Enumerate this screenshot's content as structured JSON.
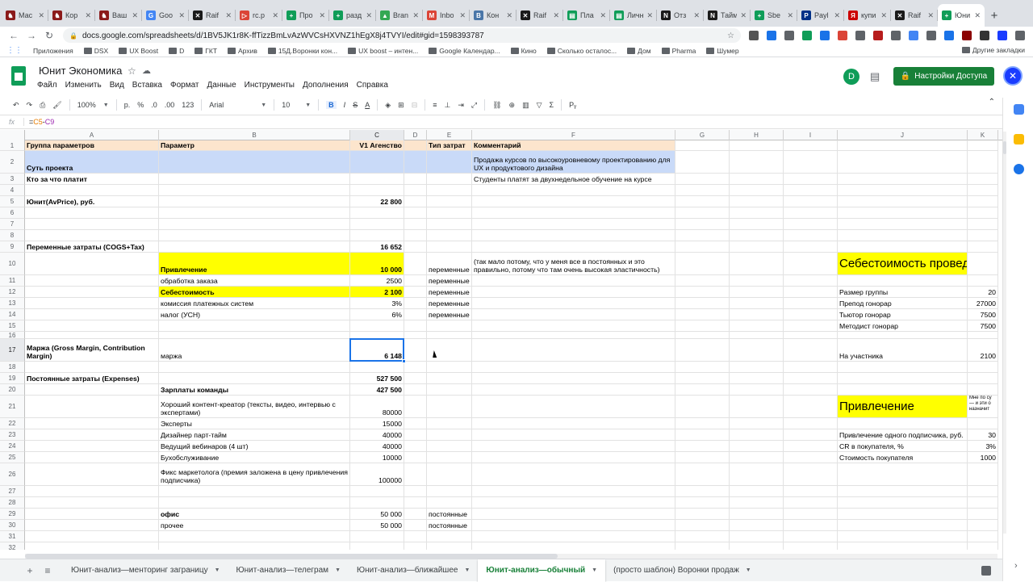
{
  "browser": {
    "tabs": [
      {
        "label": "Мас",
        "fav": "#8b1a1a",
        "glyph": "♞"
      },
      {
        "label": "Кор",
        "fav": "#8b1a1a",
        "glyph": "♞"
      },
      {
        "label": "Ваш",
        "fav": "#8b1a1a",
        "glyph": "♞"
      },
      {
        "label": "Goo",
        "fav": "#4285f4",
        "glyph": "G"
      },
      {
        "label": "Raif",
        "fav": "#1a1a1a",
        "glyph": "✕"
      },
      {
        "label": "rc.p",
        "fav": "#db4437",
        "glyph": "▷"
      },
      {
        "label": "Про",
        "fav": "#0f9d58",
        "glyph": "+"
      },
      {
        "label": "разд",
        "fav": "#0f9d58",
        "glyph": "+"
      },
      {
        "label": "Bran",
        "fav": "#34a853",
        "glyph": "▲"
      },
      {
        "label": "Inbo",
        "fav": "#db4437",
        "glyph": "M"
      },
      {
        "label": "Кон",
        "fav": "#4a76a8",
        "glyph": "В"
      },
      {
        "label": "Raif",
        "fav": "#1a1a1a",
        "glyph": "✕"
      },
      {
        "label": "Пла",
        "fav": "#0f9d58",
        "glyph": "▤"
      },
      {
        "label": "Личн",
        "fav": "#0f9d58",
        "glyph": "▤"
      },
      {
        "label": "Отз",
        "fav": "#1a1a1a",
        "glyph": "N"
      },
      {
        "label": "Тайм",
        "fav": "#1a1a1a",
        "glyph": "N"
      },
      {
        "label": "Sbe",
        "fav": "#0f9d58",
        "glyph": "+"
      },
      {
        "label": "Payl",
        "fav": "#003087",
        "glyph": "P"
      },
      {
        "label": "купи",
        "fav": "#cc0000",
        "glyph": "Я"
      },
      {
        "label": "Raif",
        "fav": "#1a1a1a",
        "glyph": "✕"
      },
      {
        "label": "Юни",
        "fav": "#0f9d58",
        "glyph": "+",
        "active": true
      }
    ],
    "url": "docs.google.com/spreadsheets/d/1BV5JK1r8K-ffTizzBmLvAzWVCsHXVNZ1hEgX8j4TVYI/edit#gid=1598393787",
    "bookmarks": [
      "Приложения",
      "DSX",
      "UX Boost",
      "D",
      "ГКТ",
      "Архив",
      "15Д.Воронки кон...",
      "UX boost – интен...",
      "Google Календар...",
      "Кино",
      "Сколько осталос...",
      "Дом",
      "Pharma",
      "Шумер"
    ],
    "other_bookmarks": "Другие закладки"
  },
  "app": {
    "title": "Юнит Экономика",
    "menu": [
      "Файл",
      "Изменить",
      "Вид",
      "Вставка",
      "Формат",
      "Данные",
      "Инструменты",
      "Дополнения",
      "Справка"
    ],
    "user_initial": "D",
    "share_label": "Настройки Доступа",
    "toolbar": {
      "zoom": "100%",
      "currency": "р.",
      "percent": "%",
      "dec_less": ".0",
      "dec_more": ".00",
      "format123": "123",
      "font": "Arial",
      "size": "10"
    }
  },
  "formula": {
    "ref1": "C5",
    "op": "-",
    "ref2": "C9",
    "prefix": "="
  },
  "columns": [
    "A",
    "B",
    "C",
    "D",
    "E",
    "F",
    "G",
    "H",
    "I",
    "J",
    "K"
  ],
  "rows": [
    1,
    2,
    3,
    4,
    5,
    6,
    7,
    8,
    9,
    10,
    11,
    12,
    13,
    14,
    15,
    16,
    17,
    18,
    19,
    20,
    21,
    22,
    23,
    24,
    25,
    26,
    27,
    28,
    29,
    30,
    31,
    32
  ],
  "cells": {
    "A1": "Группа параметров",
    "B1": "Параметр",
    "C1": "V1 Агенство",
    "E1": "Тип затрат",
    "F1": "Комментарий",
    "A2": "Суть проекта",
    "F2": "Продажа курсов по высокоуровневому проектированию для UX и продуктового дизайна",
    "A3": "Кто за что платит",
    "F3": "Студенты платят за двухнедельное обучение на курсе",
    "A5": "Юнит(AvPrice), руб.",
    "C5": "22 800",
    "A9": "Переменные затраты (COGS+Tax)",
    "C9": "16 652",
    "B10": "Привлечение",
    "C10": "10 000",
    "E10": "переменные",
    "F10": "(так мало потому, что у меня все в постоянных и это правильно, потому что там очень высокая эластичность)",
    "J10": "Себестоимость проведени",
    "B11": "обработка заказа",
    "C11": "2500",
    "E11": "переменные",
    "B12": "Себестоимость",
    "C12": "2 100",
    "E12": "переменные",
    "J12": "Размер группы",
    "K12": "20",
    "B13": "комиссия платежных систем",
    "C13": "3%",
    "E13": "переменные",
    "J13": "Препод гонорар",
    "K13": "27000",
    "B14": "налог (УСН)",
    "C14": "6%",
    "E14": "переменные",
    "J14": "Тьютор гонорар",
    "K14": "7500",
    "J15": "Методист гонорар",
    "K15": "7500",
    "A17": "Маржа (Gross Margin, Contribution Margin)",
    "B17": "маржа",
    "C17": "6 148",
    "J17": "На участника",
    "K17": "2100",
    "A19": "Постоянные затраты (Expenses)",
    "C19": "527 500",
    "B20": "Зарплаты команды",
    "C20": "427 500",
    "B21": "Хороший контент-креатор (тексты, видео, интервью с экспертами)",
    "C21": "80000",
    "J21": "Привлечение",
    "K21": "Мне по су — и эти о назначит",
    "B22": "Эксперты",
    "C22": "15000",
    "B23": "Дизайнер парт-тайм",
    "C23": "40000",
    "J23": "Привлечение одного подписчика, руб.",
    "K23": "30",
    "B24": "Ведущий вебинаров (4 шт)",
    "C24": "40000",
    "J24": "CR в покупателя, %",
    "K24": "3%",
    "B25": "Бухобслуживание",
    "C25": "10000",
    "J25": "Стоимость покупателя",
    "K25": "1000",
    "B26": "Фикс маркетолога (премия заложена в цену привлечения подписчика)",
    "C26": "100000",
    "B29": "офис",
    "C29": "50 000",
    "E29": "постоянные",
    "B30": "прочее",
    "C30": "50 000",
    "E30": "постоянные"
  },
  "sheets": [
    {
      "label": "Юнит-анализ—менторинг заграницу"
    },
    {
      "label": "Юнит-анализ—телеграм"
    },
    {
      "label": "Юнит-анализ—ближайшее"
    },
    {
      "label": "Юнит-анализ—обычный",
      "active": true
    },
    {
      "label": "(просто шаблон) Воронки продаж"
    }
  ],
  "colors": {
    "header_row": "#fce5cd",
    "blue_row": "#c9daf8",
    "highlight": "#ffff00",
    "accent": "#188038",
    "selection": "#1a73e8"
  }
}
